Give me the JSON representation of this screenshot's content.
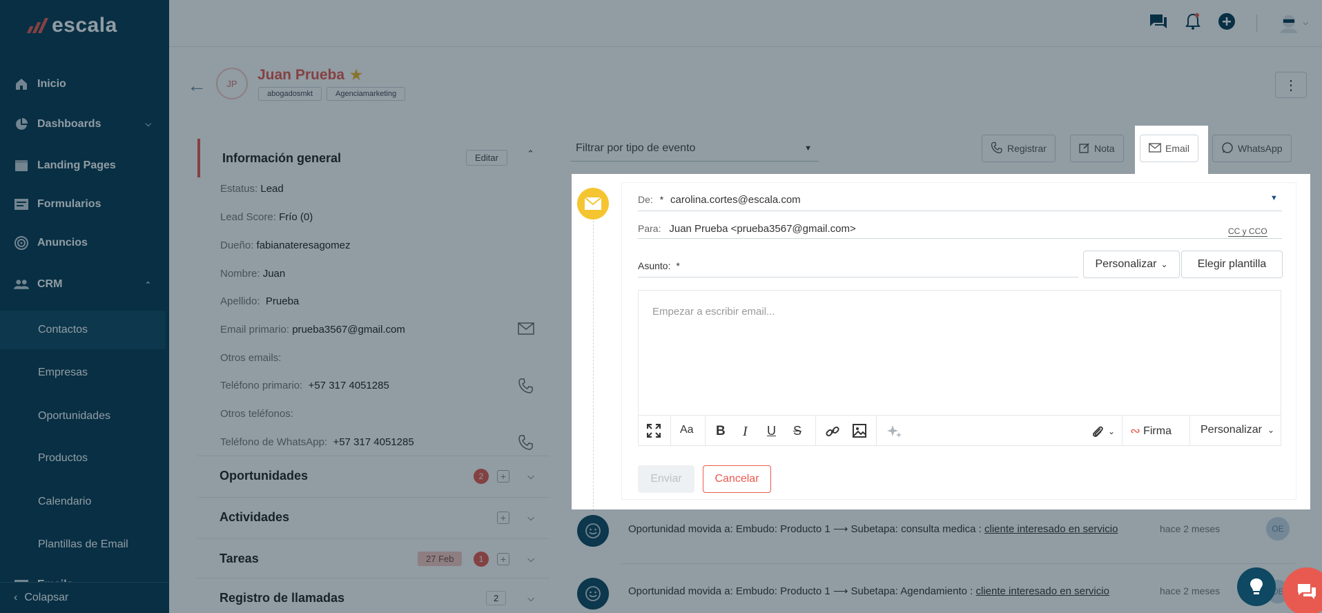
{
  "brand": {
    "name": "escala",
    "mark_color": "#e85a4f"
  },
  "colors": {
    "sidebar": "#063a52",
    "accent": "#e85a4f",
    "star": "#f0b429",
    "email_icon_bg": "#f5c531"
  },
  "sidebar": {
    "items": [
      {
        "label": "Inicio",
        "icon": "home-icon"
      },
      {
        "label": "Dashboards",
        "icon": "pie-chart-icon"
      },
      {
        "label": "Landing Pages",
        "icon": "browser-icon"
      },
      {
        "label": "Formularios",
        "icon": "form-icon"
      },
      {
        "label": "Anuncios",
        "icon": "target-icon"
      },
      {
        "label": "CRM",
        "icon": "people-icon"
      }
    ],
    "crm_sub": [
      "Contactos",
      "Empresas",
      "Oportunidades",
      "Productos",
      "Calendario",
      "Plantillas de Email",
      "Emails"
    ],
    "collapse_label": "Colapsar"
  },
  "contact": {
    "initials": "JP",
    "name": "Juan Prueba",
    "tags": [
      "abogadosmkt",
      "Agenciamarketing"
    ]
  },
  "general": {
    "title": "Información general",
    "edit_label": "Editar",
    "fields": [
      {
        "k": "Estatus:",
        "v": "Lead"
      },
      {
        "k": "Lead Score:",
        "v": "Frío (0)"
      },
      {
        "k": "Dueño:",
        "v": "fabianateresagomez"
      },
      {
        "k": "Nombre:",
        "v": "Juan"
      },
      {
        "k": "Apellido:",
        "v": "Prueba"
      },
      {
        "k": "Email primario:",
        "v": "prueba3567@gmail.com"
      },
      {
        "k": "Otros emails:",
        "v": ""
      },
      {
        "k": "Teléfono primario:",
        "v": "+57 317 4051285"
      },
      {
        "k": "Otros teléfonos:",
        "v": ""
      },
      {
        "k": "Teléfono de WhatsApp:",
        "v": "+57 317 4051285"
      }
    ]
  },
  "sections": {
    "oportunidades": {
      "title": "Oportunidades",
      "badge": "2"
    },
    "actividades": {
      "title": "Actividades"
    },
    "tareas": {
      "title": "Tareas",
      "date": "27 Feb",
      "badge": "1"
    },
    "llamadas": {
      "title": "Registro de llamadas",
      "count": "2"
    }
  },
  "filter": {
    "placeholder": "Filtrar por tipo de evento"
  },
  "actions": {
    "registrar": "Registrar",
    "nota": "Nota",
    "email": "Email",
    "whatsapp": "WhatsApp"
  },
  "composer": {
    "from_label": "De:",
    "from_value": "carolina.cortes@escala.com",
    "to_label": "Para:",
    "to_value": "Juan Prueba <prueba3567@gmail.com>",
    "cc_label": "CC y CCO",
    "subject_label": "Asunto:",
    "personalizar": "Personalizar",
    "elegir_plantilla": "Elegir plantilla",
    "editor_placeholder": "Empezar a escribir email...",
    "toolbar_font": "Aa",
    "firma": "Firma",
    "toolbar_personalizar": "Personalizar",
    "send": "Enviar",
    "cancel": "Cancelar"
  },
  "timeline": [
    {
      "text": "Oportunidad movida a: Embudo: Producto 1 ⟶ Subetapa: consulta medica : ",
      "link": "cliente interesado en servicio",
      "time": "hace 2 meses",
      "user": "OE"
    },
    {
      "text": "Oportunidad movida a: Embudo: Producto 1 ⟶ Subetapa: Agendamiento : ",
      "link": "cliente interesado en servicio",
      "time": "hace 2 meses",
      "user": "OE"
    }
  ]
}
